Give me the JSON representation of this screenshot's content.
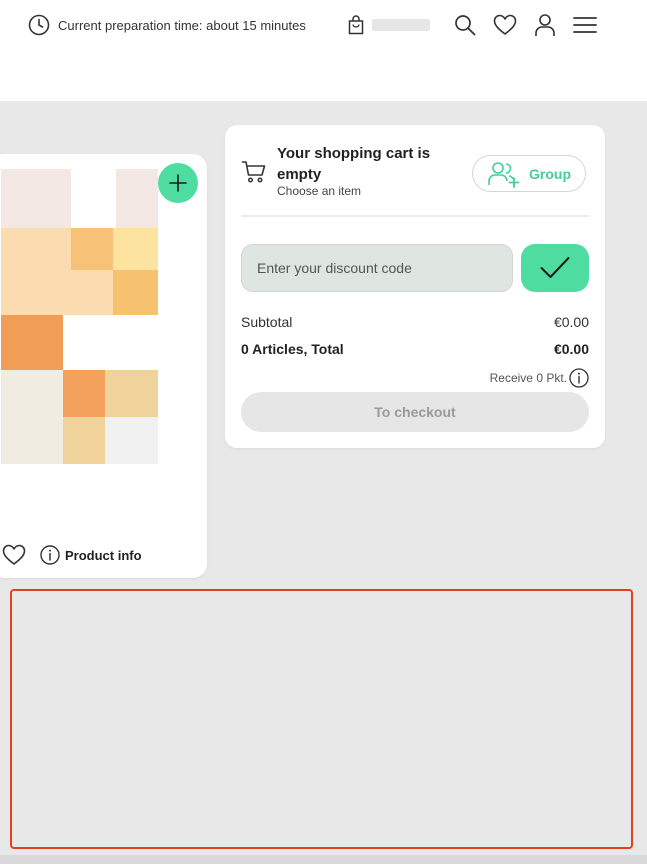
{
  "header": {
    "prep_time_text": "Current preparation time: about 15 minutes",
    "icons": [
      "clock-icon",
      "shopping-bag-icon",
      "search-icon",
      "heart-icon",
      "user-icon",
      "menu-icon"
    ]
  },
  "product_card": {
    "info_label": "Product info",
    "mosaic_colors": [
      "#f3e8e4",
      "#fbdcb0",
      "#f8c178",
      "#fce39f",
      "#f6c26f",
      "#f29d55",
      "#f1ece1",
      "#f3a15c",
      "#f0d39b",
      "#f1f1f1"
    ]
  },
  "cart": {
    "title": "Your shopping cart is empty",
    "subtitle": "Choose an item",
    "group_label": "Group",
    "discount_placeholder": "Enter your discount code",
    "subtotal_label": "Subtotal",
    "subtotal_value": "€0.00",
    "total_label": "0 Articles, Total",
    "total_value": "€0.00",
    "points_text": "Receive 0 Pkt.",
    "checkout_label": "To checkout"
  },
  "colors": {
    "accent": "#4fdca0",
    "accent_text": "#3fd195",
    "background": "#e8e8e8",
    "highlight": "#e0411f"
  }
}
